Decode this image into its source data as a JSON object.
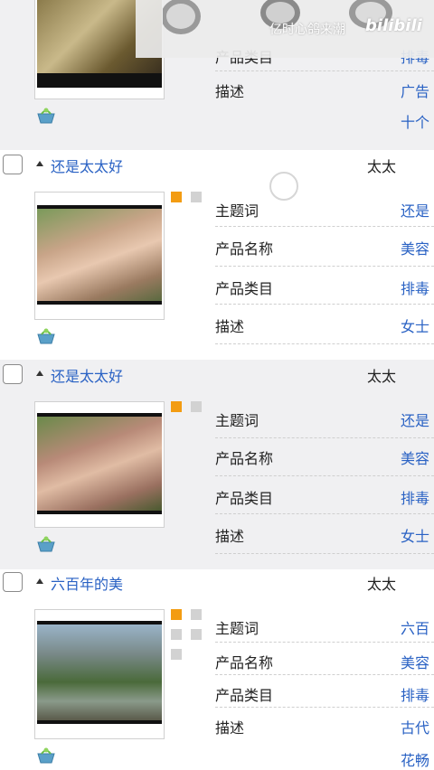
{
  "labels": {
    "keyword": "主题词",
    "product_name": "产品名称",
    "product_category": "产品类目",
    "description": "描述"
  },
  "top_record": {
    "partial_label": "产品类目",
    "partial_value": "排毒",
    "description_label": "描述",
    "description_value": "广告",
    "extra_value": "十个"
  },
  "records": [
    {
      "title": "还是太太好",
      "tag": "太太",
      "keyword": "还是",
      "product_name": "美容",
      "product_category": "排毒",
      "description": "女士"
    },
    {
      "title": "还是太太好",
      "tag": "太太",
      "keyword": "还是",
      "product_name": "美容",
      "product_category": "排毒",
      "description": "女士"
    },
    {
      "title": "六百年的美",
      "tag": "太太",
      "keyword": "六百",
      "product_name": "美容",
      "product_category": "排毒",
      "description": "古代",
      "extra": "花畅"
    }
  ],
  "watermark": {
    "text": "亿时心鸽来潮",
    "logo": "bilibili"
  },
  "colors": {
    "link": "#2a62c4",
    "orange_square": "#f39c12",
    "gray_square": "#d2d2d2",
    "alt_row_bg": "#f0f0f2"
  }
}
